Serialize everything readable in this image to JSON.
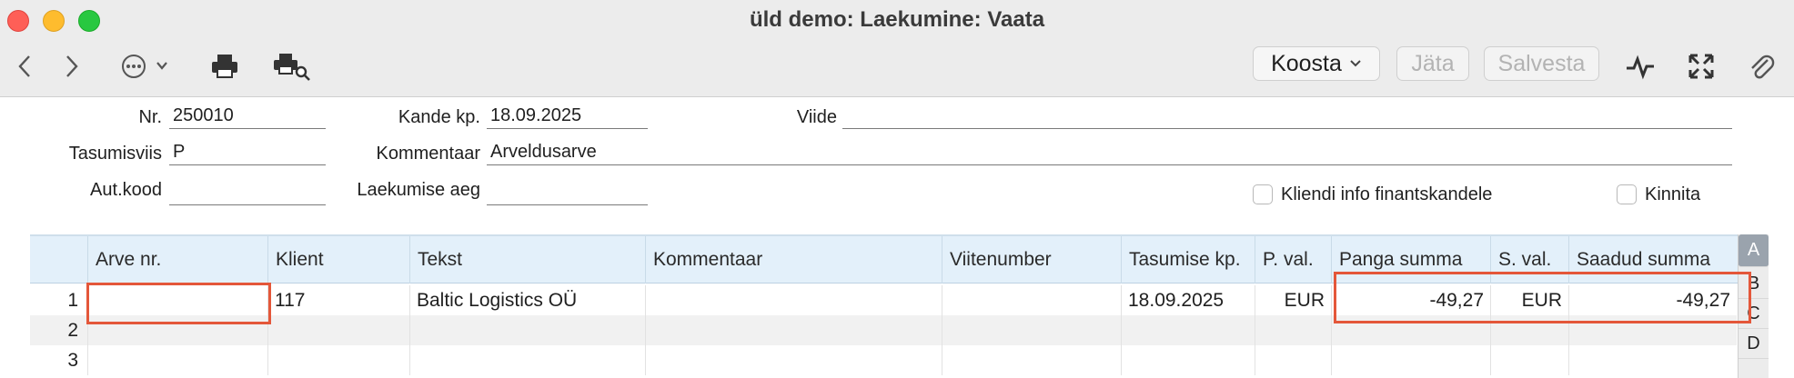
{
  "window": {
    "title": "üld demo: Laekumine: Vaata"
  },
  "toolbar": {
    "koosta_label": "Koosta",
    "jata_label": "Jäta",
    "salvesta_label": "Salvesta"
  },
  "form": {
    "nr": {
      "label": "Nr.",
      "value": "250010"
    },
    "kande_kp": {
      "label": "Kande kp.",
      "value": "18.09.2025"
    },
    "viide": {
      "label": "Viide",
      "value": ""
    },
    "tasumisviis": {
      "label": "Tasumisviis",
      "value": "P"
    },
    "kommentaar": {
      "label": "Kommentaar",
      "value": "Arveldusarve"
    },
    "aut_kood": {
      "label": "Aut.kood",
      "value": ""
    },
    "laekumise_aeg": {
      "label": "Laekumise aeg",
      "value": ""
    },
    "kliendi_info": {
      "label": "Kliendi info finantskandele",
      "checked": false
    },
    "kinnita": {
      "label": "Kinnita",
      "checked": false
    }
  },
  "table": {
    "columns": [
      "Arve nr.",
      "Klient",
      "Tekst",
      "Kommentaar",
      "Viitenumber",
      "Tasumise kp.",
      "P. val.",
      "Panga summa",
      "S. val.",
      "Saadud summa"
    ],
    "rows": [
      {
        "n": "1",
        "arve_nr": "",
        "klient": "117",
        "tekst": "Baltic Logistics OÜ",
        "kommentaar": "",
        "viitenumber": "",
        "tasumise_kp": "18.09.2025",
        "p_val": "EUR",
        "panga_summa": "-49,27",
        "s_val": "EUR",
        "saadud_summa": "-49,27"
      },
      {
        "n": "2",
        "arve_nr": "",
        "klient": "",
        "tekst": "",
        "kommentaar": "",
        "viitenumber": "",
        "tasumise_kp": "",
        "p_val": "",
        "panga_summa": "",
        "s_val": "",
        "saadud_summa": ""
      },
      {
        "n": "3",
        "arve_nr": "",
        "klient": "",
        "tekst": "",
        "kommentaar": "",
        "viitenumber": "",
        "tasumise_kp": "",
        "p_val": "",
        "panga_summa": "",
        "s_val": "",
        "saadud_summa": ""
      }
    ],
    "side_letters": [
      "A",
      "B",
      "C",
      "D"
    ]
  },
  "colors": {
    "highlight": "#e4573a",
    "header_bg": "#e3f0fa"
  }
}
